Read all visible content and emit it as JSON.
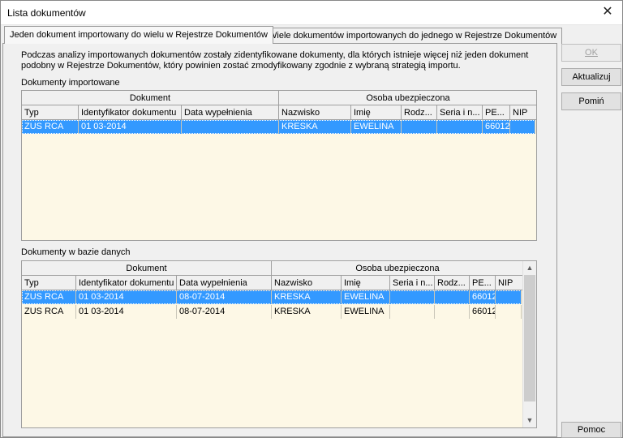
{
  "window": {
    "title": "Lista dokumentów",
    "close_glyph": "✕"
  },
  "tabs": [
    {
      "label": "Jeden dokument importowany do wielu w Rejestrze Dokumentów",
      "active": true
    },
    {
      "label": "Wiele dokumentów importowanych do jednego w Rejestrze Dokumentów",
      "active": false
    }
  ],
  "description": {
    "line1": "Podczas analizy importowanych dokumentów zostały zidentyfikowane dokumenty, dla których istnieje więcej niż jeden dokument",
    "line2": "podobny w Rejestrze Dokumentów, który powinien zostać zmodyfikowany zgodnie z wybraną strategią importu."
  },
  "imported": {
    "section_label": "Dokumenty importowane",
    "group_headers": [
      "Dokument",
      "Osoba ubezpieczona"
    ],
    "columns": [
      "Typ",
      "Identyfikator dokumentu",
      "Data wypełnienia",
      "Nazwisko",
      "Imię",
      "Rodz...",
      "Seria i n...",
      "PE...",
      "NIP"
    ],
    "rows": [
      {
        "cells": [
          "ZUS RCA",
          "01 03-2014",
          "",
          "KRESKA",
          "EWELINA",
          "",
          "",
          "66012",
          ""
        ],
        "selected": true
      }
    ]
  },
  "database": {
    "section_label": "Dokumenty w bazie danych",
    "group_headers": [
      "Dokument",
      "Osoba ubezpieczona"
    ],
    "columns": [
      "Typ",
      "Identyfikator dokumentu",
      "Data wypełnienia",
      "Nazwisko",
      "Imię",
      "Seria i n...",
      "Rodz...",
      "PE...",
      "NIP"
    ],
    "rows": [
      {
        "cells": [
          "ZUS RCA",
          "01 03-2014",
          "08-07-2014",
          "KRESKA",
          "EWELINA",
          "",
          "",
          "66012",
          ""
        ],
        "selected": true
      },
      {
        "cells": [
          "ZUS RCA",
          "01 03-2014",
          "08-07-2014",
          "KRESKA",
          "EWELINA",
          "",
          "",
          "66012",
          ""
        ],
        "selected": false
      }
    ]
  },
  "buttons": {
    "ok": "OK",
    "refresh": "Aktualizuj",
    "skip": "Pomiń",
    "help": "Pomoc"
  },
  "scrollbar": {
    "up_glyph": "▲",
    "down_glyph": "▼"
  }
}
